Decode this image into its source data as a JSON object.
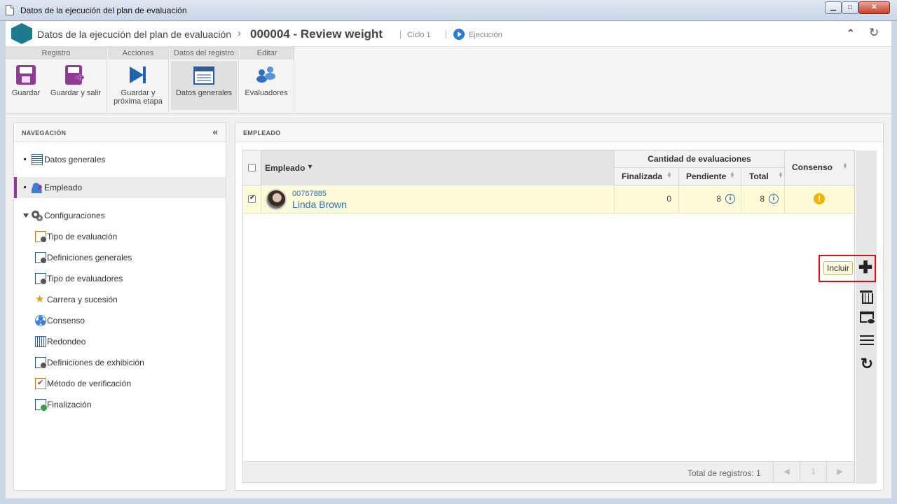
{
  "window": {
    "title": "Datos de la ejecución del plan de evaluación",
    "min_glyph": "▁",
    "max_glyph": "□",
    "close_glyph": "✕"
  },
  "header": {
    "logo_text": "",
    "title": "Datos de la ejecución del plan de evaluación",
    "arrow": "›",
    "record": "000004 - Review weight",
    "sep1": "|",
    "cycle": "Ciclo 1",
    "sep2": "|",
    "status": "Ejecución",
    "collapse_glyph": "⌃",
    "refresh_glyph": "↻"
  },
  "ribbon": {
    "groups": [
      "Registro",
      "Acciones",
      "Datos del registro",
      "Editar"
    ],
    "buttons": {
      "save": "Guardar",
      "save_exit": "Guardar y salir",
      "save_next_line1": "Guardar y",
      "save_next_line2": "próxima etapa",
      "general": "Datos generales",
      "evaluators": "Evaluadores"
    }
  },
  "navigation": {
    "title": "NAVEGACIÓN",
    "collapse_glyph": "«",
    "items": [
      {
        "label": "Datos generales"
      },
      {
        "label": "Empleado"
      },
      {
        "label": "Configuraciones"
      }
    ],
    "sub_items": [
      {
        "label": "Tipo de evaluación"
      },
      {
        "label": "Definiciones generales"
      },
      {
        "label": "Tipo de evaluadores"
      },
      {
        "label": "Carrera y sucesión"
      },
      {
        "label": "Consenso"
      },
      {
        "label": "Redondeo"
      },
      {
        "label": "Definiciones de exhibición"
      },
      {
        "label": "Método de verificación"
      },
      {
        "label": "Finalización"
      }
    ]
  },
  "main": {
    "title": "EMPLEADO",
    "grid": {
      "columns": {
        "employee": "Empleado",
        "group": "Cantidad de evaluaciones",
        "finished": "Finalizada",
        "pending": "Pendiente",
        "total": "Total",
        "consensus": "Consenso"
      },
      "sort_asc": "▲",
      "sort_desc": "▼",
      "sort_down": "▾",
      "info_glyph": "i",
      "warn_glyph": "!",
      "rows": [
        {
          "code": "00767885",
          "name": "Linda Brown",
          "finished": "0",
          "pending": "8",
          "total": "8",
          "checked": true
        }
      ],
      "footer": {
        "total_text": "Total de registros: 1",
        "prev": "◀",
        "page": "1",
        "next": "▶"
      }
    },
    "toolbar": {
      "add_glyph": "✚",
      "add_tooltip": "Incluir",
      "refresh_glyph": "↻"
    }
  }
}
